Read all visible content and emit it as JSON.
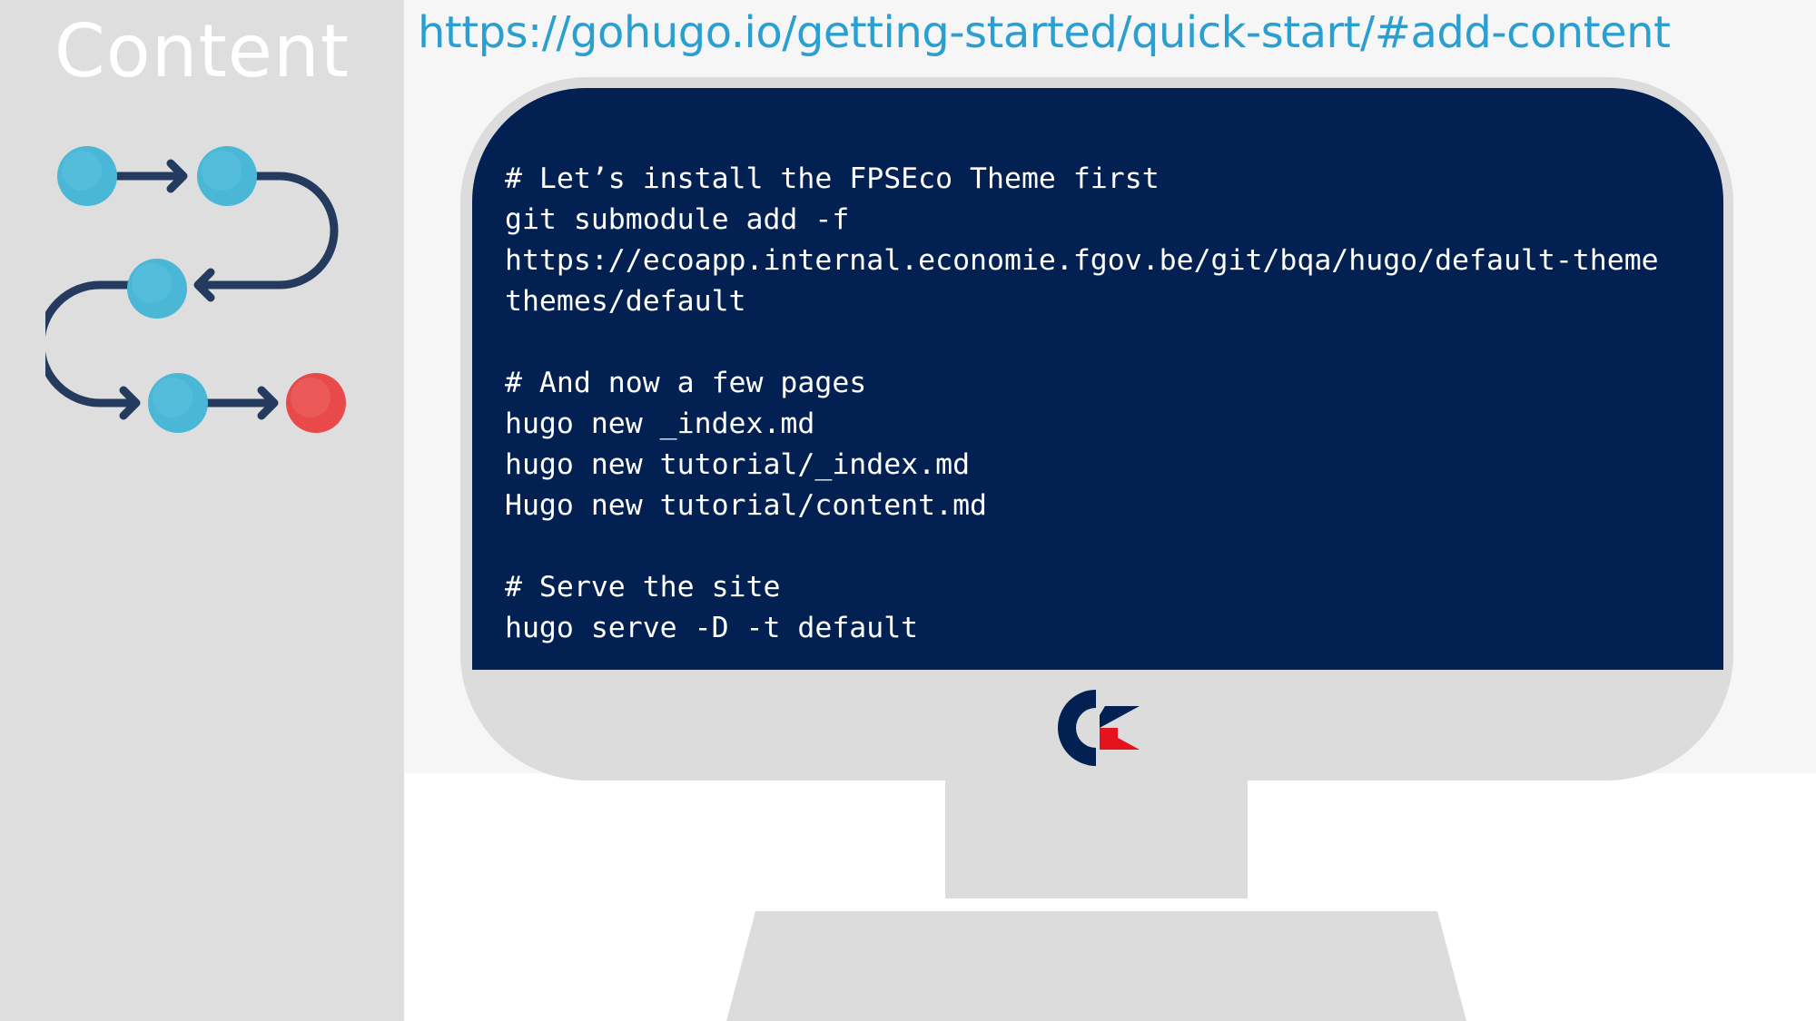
{
  "sidebar": {
    "title": "Content"
  },
  "header": {
    "url": "https://gohugo.io/getting-started/quick-start/#add-content"
  },
  "terminal": {
    "lines": [
      "# Let’s install the FPSEco Theme first",
      "git submodule add -f",
      "https://ecoapp.internal.economie.fgov.be/git/bqa/hugo/default-theme",
      "themes/default",
      "",
      "# And now a few pages",
      "hugo new _index.md",
      "hugo new tutorial/_index.md",
      "Hugo new tutorial/content.md",
      "",
      "# Serve the site",
      "hugo serve -D -t default"
    ]
  },
  "diagram": {
    "node_colors": [
      "#4ab7d6",
      "#4ab7d6",
      "#4ab7d6",
      "#4ab7d6",
      "#e84a4a"
    ],
    "connector_color": "#243a5e"
  },
  "logo": {
    "name": "commodore-style-logo",
    "colors": [
      "#022152",
      "#e5131d"
    ]
  },
  "colors": {
    "sidebar_bg": "#dedede",
    "screen_bg": "#022152",
    "monitor_frame": "#dcdcdc",
    "link": "#2a9fd0"
  }
}
